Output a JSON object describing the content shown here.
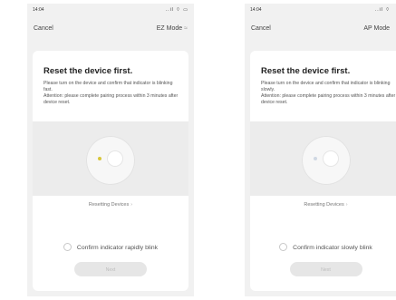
{
  "screens": [
    {
      "status_time": "14:04",
      "status_icons": "..il ⌔ ▭",
      "cancel_label": "Cancel",
      "mode_label": "EZ Mode",
      "title": "Reset the device first.",
      "description_line1": "Please turn on the device and confirm that indicator is blinking fast.",
      "description_line2": "Attention: please complete pairing process within 3 minutes after device reset.",
      "resetting_link": "Resetting Devices",
      "confirm_label": "Confirm indicator rapidly blink",
      "next_label": "Next",
      "led_color": "#d8c63a"
    },
    {
      "status_time": "14:04",
      "status_icons": "..il ⌔",
      "cancel_label": "Cancel",
      "mode_label": "AP Mode",
      "title": "Reset the device first.",
      "description_line1": "Please turn on the device and confirm that indicator is blinking slowly.",
      "description_line2": "Attention: please complete pairing process within 3 minutes after device reset.",
      "resetting_link": "Resetting Devices",
      "confirm_label": "Confirm indicator slowly blink",
      "next_label": "Next",
      "led_color": "#cfd8e3"
    }
  ]
}
